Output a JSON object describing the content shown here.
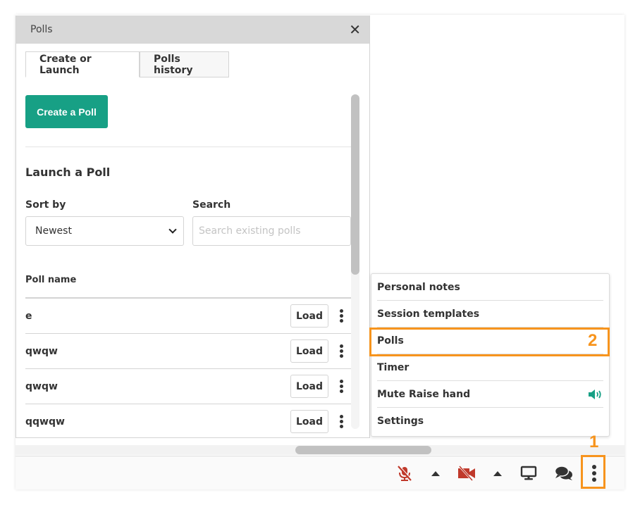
{
  "polls_panel": {
    "title": "Polls",
    "close_icon": "close-icon",
    "tabs": [
      {
        "label": "Create or Launch",
        "active": true
      },
      {
        "label": "Polls history",
        "active": false
      }
    ],
    "create_button": "Create a Poll",
    "section_title": "Launch a Poll",
    "sort_label": "Sort by",
    "sort_value": "Newest",
    "search_label": "Search",
    "search_placeholder": "Search existing polls",
    "search_value": "",
    "column_header": "Poll name",
    "polls": [
      {
        "name": "e",
        "action": "Load"
      },
      {
        "name": "qwqw",
        "action": "Load"
      },
      {
        "name": "qwqw",
        "action": "Load"
      },
      {
        "name": "qqwqw",
        "action": "Load"
      }
    ]
  },
  "more_menu": {
    "items": [
      {
        "label": "Personal notes"
      },
      {
        "label": "Session templates"
      },
      {
        "label": "Polls",
        "highlighted": true
      },
      {
        "label": "Timer"
      },
      {
        "label": "Mute Raise hand",
        "icon": "speaker-volume-icon"
      },
      {
        "label": "Settings"
      }
    ]
  },
  "toolbar": {
    "items": [
      {
        "name": "microphone-muted",
        "icon": "microphone-slash-icon"
      },
      {
        "name": "microphone-options",
        "icon": "caret-up-icon"
      },
      {
        "name": "camera-off",
        "icon": "video-slash-icon"
      },
      {
        "name": "camera-options",
        "icon": "caret-up-icon"
      },
      {
        "name": "screen-share",
        "icon": "desktop-icon"
      },
      {
        "name": "chat",
        "icon": "comments-icon"
      },
      {
        "name": "more-options",
        "icon": "ellipsis-vertical-icon"
      }
    ]
  },
  "annotations": {
    "step1": "1",
    "step2": "2"
  },
  "colors": {
    "accent_green": "#17a085",
    "muted_red": "#c0392b",
    "annotation_orange": "#f7941d",
    "header_gray": "#d8d8d8"
  }
}
